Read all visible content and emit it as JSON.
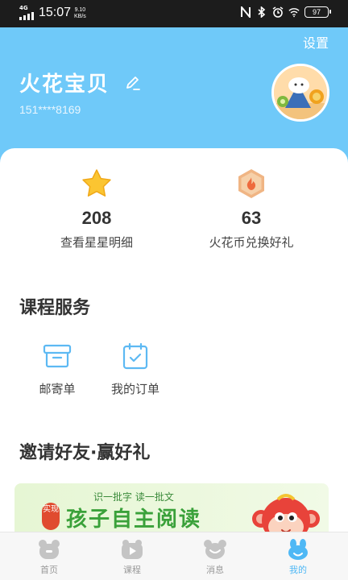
{
  "status_bar": {
    "network": "4G",
    "time": "15:07",
    "speed_value": "9.10",
    "speed_unit": "KB/s",
    "battery": "97"
  },
  "header": {
    "settings_label": "设置",
    "username": "火花宝贝",
    "phone": "151****8169"
  },
  "stats": [
    {
      "icon": "star-icon",
      "value": "208",
      "label": "查看星星明细"
    },
    {
      "icon": "spark-coin-icon",
      "value": "63",
      "label": "火花币兑换好礼"
    }
  ],
  "course_services": {
    "title": "课程服务",
    "items": [
      {
        "icon": "box-icon",
        "label": "邮寄单"
      },
      {
        "icon": "order-check-icon",
        "label": "我的订单"
      }
    ]
  },
  "invite": {
    "title": "邀请好友·赢好礼",
    "banner_subtitle": "识一批字 读一批文",
    "banner_seal": "实现",
    "banner_title": "孩子自主阅读"
  },
  "tabbar": {
    "active_color": "#4fb8f5",
    "inactive_color": "#bfbfbf",
    "items": [
      {
        "label": "首页",
        "active": false
      },
      {
        "label": "课程",
        "active": false
      },
      {
        "label": "消息",
        "active": false
      },
      {
        "label": "我的",
        "active": true
      }
    ]
  }
}
